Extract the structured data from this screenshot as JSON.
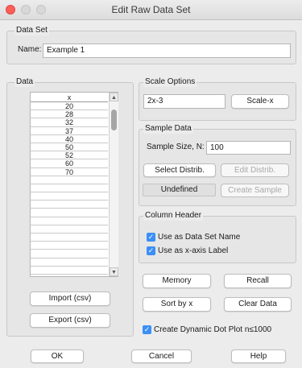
{
  "window": {
    "title": "Edit Raw Data Set"
  },
  "data_set": {
    "group_label": "Data Set",
    "name_label": "Name:",
    "name_value": "Example 1"
  },
  "data": {
    "group_label": "Data",
    "column_header": "x",
    "rows": [
      "20",
      "28",
      "32",
      "37",
      "40",
      "50",
      "52",
      "60",
      "70",
      "",
      "",
      "",
      "",
      "",
      "",
      "",
      "",
      "",
      "",
      "",
      ""
    ]
  },
  "scale": {
    "group_label": "Scale Options",
    "expression": "2x-3",
    "button": "Scale-x"
  },
  "sample": {
    "group_label": "Sample Data",
    "size_label": "Sample Size, N:",
    "size_value": "100",
    "select_button": "Select Distrib.",
    "edit_button": "Edit Distrib.",
    "status": "Undefined",
    "create_button": "Create Sample"
  },
  "column_header": {
    "group_label": "Column Header",
    "opt1": "Use as Data Set Name",
    "opt2": "Use as x-axis Label",
    "opt1_checked": true,
    "opt2_checked": true
  },
  "actions": {
    "memory": "Memory",
    "recall": "Recall",
    "sort": "Sort by x",
    "clear": "Clear Data",
    "import": "Import (csv)",
    "export": "Export (csv)",
    "dot_plot": "Create Dynamic Dot Plot n≤1000",
    "dot_plot_checked": true
  },
  "footer": {
    "ok": "OK",
    "cancel": "Cancel",
    "help": "Help"
  },
  "colors": {
    "accent": "#3b8ff6",
    "close": "#fc5f57"
  }
}
